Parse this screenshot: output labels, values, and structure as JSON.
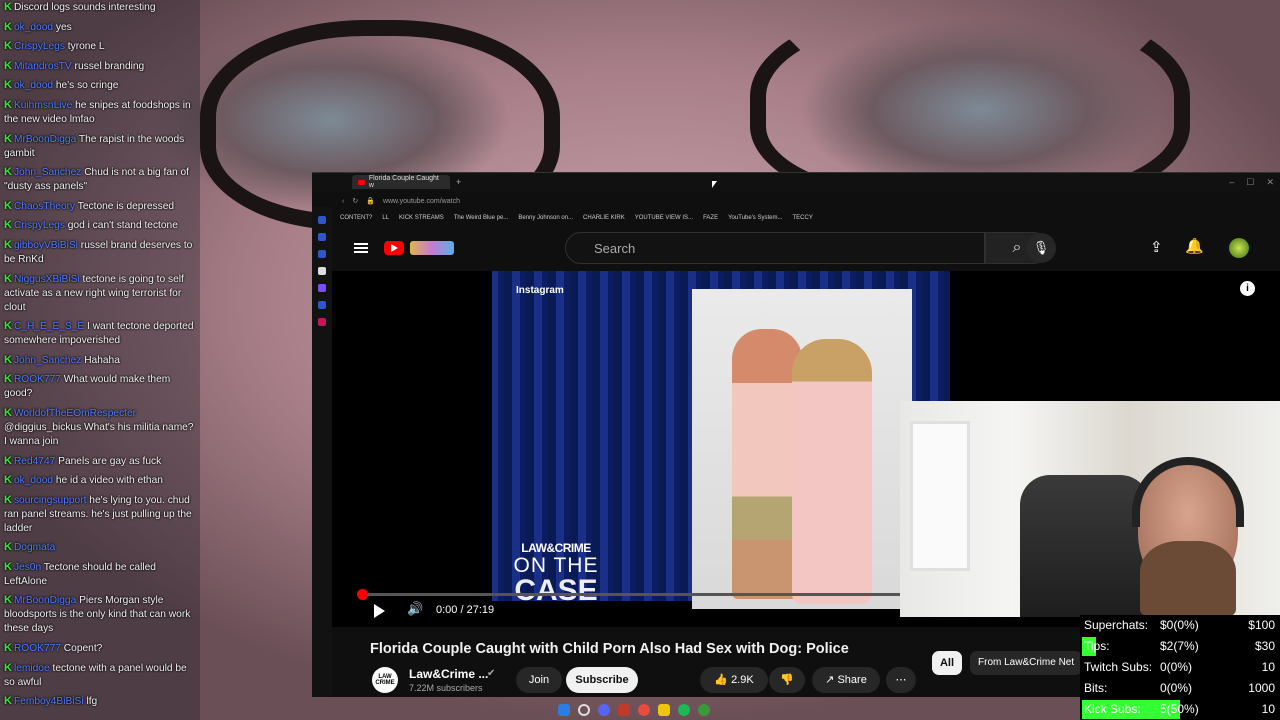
{
  "chat": [
    {
      "user": "",
      "text": "Discord logs sounds interesting"
    },
    {
      "user": "ok_dood",
      "text": "yes"
    },
    {
      "user": "CrispyLegs",
      "text": "tyrone L"
    },
    {
      "user": "MitandrosTV",
      "text": "russel branding"
    },
    {
      "user": "ok_dood",
      "text": "he's so cringe"
    },
    {
      "user": "KuihmsnLive",
      "text": "he snipes at foodshops in the new video lmfao"
    },
    {
      "user": "MrBoonDigga",
      "text": "The rapist in the woods gambit"
    },
    {
      "user": "John_Sanchez",
      "text": "Chud is not a big fan of \"dusty ass panels\""
    },
    {
      "user": "ChaosTheory",
      "text": "Tectone is depressed"
    },
    {
      "user": "CrispyLegs",
      "text": "god i can't stand tectone"
    },
    {
      "user": "gibboyVBiBiSi",
      "text": "russel brand deserves to be RnKd"
    },
    {
      "user": "NiggusXBiBiSi",
      "text": "tectone is going to self activate as a new right wing terrorist for clout"
    },
    {
      "user": "C_H_E_E_S_E",
      "text": "I want tectone deported somewhere impoverished"
    },
    {
      "user": "John_Sanchez",
      "text": "Hahaha"
    },
    {
      "user": "ROOK777",
      "text": "What would make them good?"
    },
    {
      "user": "WorldofTheEOmRespecter",
      "text": "@diggius_bickus What's his militia name? I wanna join"
    },
    {
      "user": "Red4747",
      "text": "Panels are gay as fuck"
    },
    {
      "user": "ok_dood",
      "text": "he id a video with ethan"
    },
    {
      "user": "sourcingsupport",
      "text": "he's lying to you. chud ran panel streams. he's just pulling up the ladder"
    },
    {
      "user": "Dogmata",
      "text": ""
    },
    {
      "user": "Jes0n",
      "text": "Tectone should be called LeftAlone"
    },
    {
      "user": "MrBoonDigga",
      "text": "Piers Morgan style bloodsports is the only kind that can work these days"
    },
    {
      "user": "ROOK777",
      "text": "Copent?"
    },
    {
      "user": "lemidoe",
      "text": "tectone with a panel would be so awful"
    },
    {
      "user": "Femboy4BiBiSi",
      "text": "lfg"
    }
  ],
  "browser": {
    "tab_title": "Florida Couple Caught w",
    "url": "www.youtube.com/watch",
    "bookmarks": [
      "CONTENT?",
      "LL",
      "KICK STREAMS",
      "The Weird Blue pe...",
      "Benny Johnson on...",
      "CHARLIE KIRK",
      "YOUTUBE VIEW IS...",
      "FAZE",
      "YouTube's System...",
      "TECCY"
    ]
  },
  "youtube": {
    "search_placeholder": "Search",
    "instagram_label": "Instagram",
    "brand_top": "LAW&CRIME",
    "brand_mid": "ON THE",
    "brand_bottom": "CASE",
    "time": "0:00 / 27:19",
    "progress": 0.0,
    "title": "Florida Couple Caught with Child Porn Also Had Sex with Dog: Police",
    "channel": "Law&Crime ...",
    "subscribers": "7.22M subscribers",
    "join": "Join",
    "subscribe": "Subscribe",
    "likes": "2.9K",
    "share": "Share",
    "chip_all": "All",
    "chip_from": "From Law&Crime Net",
    "channel_avatar": "LAW CRIME"
  },
  "stats": [
    {
      "label": "Superchats:",
      "value": "$0(0%)",
      "goal": "$100",
      "highlight": false
    },
    {
      "label": "Tips:",
      "value": "$2(7%)",
      "goal": "$30",
      "highlight": false
    },
    {
      "label": "Twitch Subs:",
      "value": "0(0%)",
      "goal": "10",
      "highlight": false
    },
    {
      "label": "Bits:",
      "value": "0(0%)",
      "goal": "1000",
      "highlight": false
    },
    {
      "label": "Kick Subs:",
      "value": "5(50%)",
      "goal": "10",
      "highlight": true
    }
  ],
  "colors": {
    "accent_green": "#33ff33",
    "youtube_red": "#ff0000",
    "username_blue": "#4f7cff"
  }
}
